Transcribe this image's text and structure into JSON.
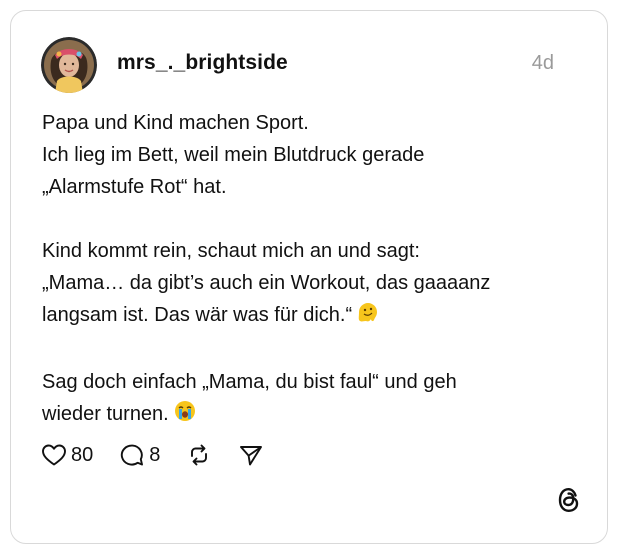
{
  "post": {
    "username": "mrs_._brightside",
    "time": "4d",
    "paragraphs": [
      "Papa und Kind machen Sport.\nIch lieg im Bett, weil mein Blutdruck gerade\n„Alarmstufe Rot“ hat.",
      "Kind kommt rein, schaut mich an und sagt:\n„Mama… da gibt’s auch ein Workout, das gaaaanz\nlangsam ist. Das wär was für dich.“",
      "Sag doch einfach „Mama, du bist faul“ und geh\nwieder turnen."
    ],
    "emojis": [
      "melting-face-emoji",
      "loudly-crying-face-emoji"
    ]
  },
  "actions": {
    "likes": "80",
    "replies": "8",
    "icons": [
      "heart-icon",
      "comment-icon",
      "repost-icon",
      "share-icon"
    ]
  },
  "brand": {
    "logo": "threads-logo-icon",
    "text_color": "#111111",
    "muted_color": "#9a9a9a",
    "border_color": "#d9d9d9"
  }
}
